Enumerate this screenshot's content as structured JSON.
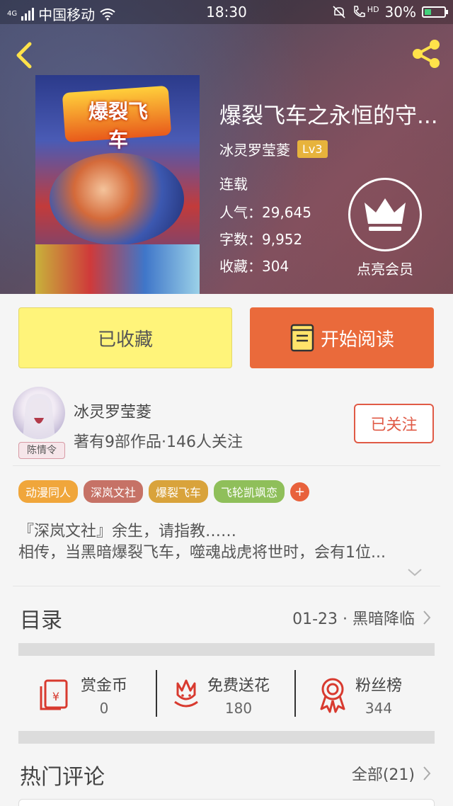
{
  "status_bar": {
    "carrier": "中国移动",
    "time": "18:30",
    "battery": "30%",
    "network": "4G",
    "hd": "HD"
  },
  "book": {
    "cover_title": "爆裂飞车",
    "title": "爆裂飞车之永恒的守...",
    "author": "冰灵罗莹菱",
    "level": "Lv3",
    "status": "连载",
    "popularity_label": "人气：",
    "popularity": "29,645",
    "words_label": "字数：",
    "words": "9,952",
    "favorites_label": "收藏：",
    "favorites": "304"
  },
  "vip": {
    "label": "点亮会员"
  },
  "actions": {
    "favorited_label": "已收藏",
    "read_label": "开始阅读"
  },
  "author_card": {
    "name": "冰灵罗莹菱",
    "stats": "著有9部作品·146人关注",
    "follow_label": "已关注",
    "avatar_tag": "陈情令"
  },
  "tags": [
    {
      "label": "动漫同人",
      "color": "#f0a63b"
    },
    {
      "label": "深岚文社",
      "color": "#c67266"
    },
    {
      "label": "爆裂飞车",
      "color": "#d9a33b"
    },
    {
      "label": "飞轮凯飒恋",
      "color": "#8fbf5a"
    }
  ],
  "tag_add": "+",
  "description": {
    "line1": "『深岚文社』余生，请指教……",
    "line2": "相传，当黑暗爆裂飞车，噬魂战虎将世时，会有1位..."
  },
  "toc": {
    "title": "目录",
    "latest": "01-23 · 黑暗降临"
  },
  "stats": [
    {
      "label": "赏金币",
      "value": "0",
      "icon": "red-envelope-icon"
    },
    {
      "label": "免费送花",
      "value": "180",
      "icon": "flower-icon"
    },
    {
      "label": "粉丝榜",
      "value": "344",
      "icon": "medal-icon"
    }
  ],
  "comments": {
    "title": "热门评论",
    "all_label": "全部(21)"
  },
  "colors": {
    "accent": "#ea6a3b",
    "favorite_btn": "#fff47a",
    "follow": "#e05a46",
    "icon_red": "#d83a2f"
  }
}
